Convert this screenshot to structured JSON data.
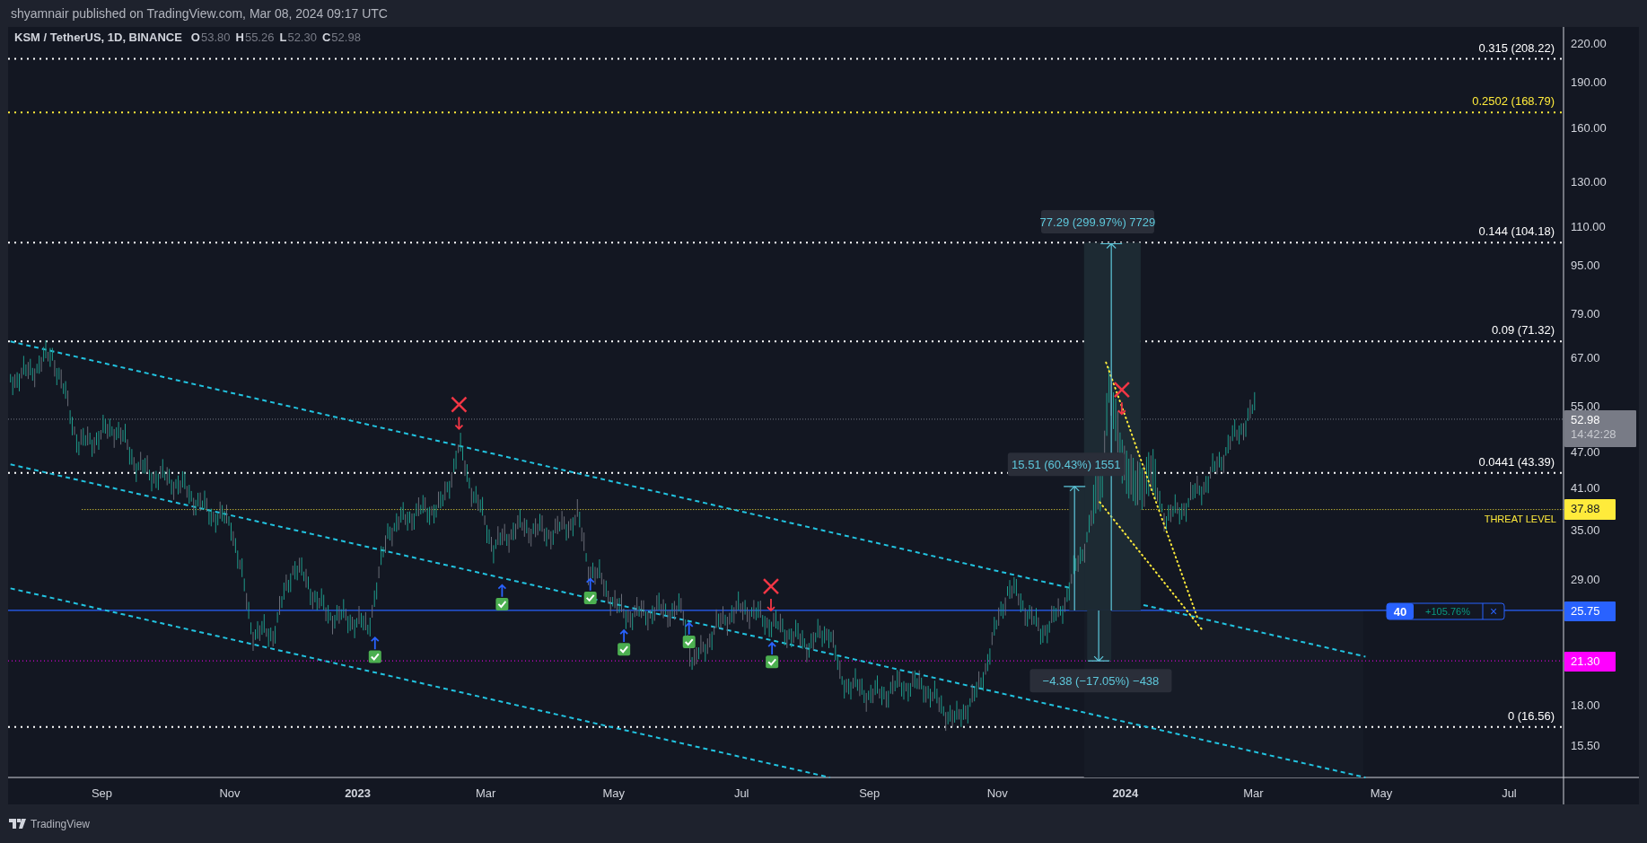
{
  "header": {
    "text": "shyamnair published on TradingView.com, Mar 08, 2024 09:17 UTC"
  },
  "legend": {
    "symbol": "KSM / TetherUS, 1D, BINANCE",
    "ohlc": [
      {
        "label": "O",
        "value": "53.80"
      },
      {
        "label": "H",
        "value": "55.26"
      },
      {
        "label": "L",
        "value": "52.30"
      },
      {
        "label": "C",
        "value": "52.98"
      }
    ]
  },
  "price_axis": [
    "220.00",
    "190.00",
    "160.00",
    "130.00",
    "110.00",
    "95.00",
    "79.00",
    "67.00",
    "55.00",
    "47.00",
    "41.00",
    "35.00",
    "29.00",
    "18.00",
    "15.50"
  ],
  "time_axis": [
    {
      "label": "Sep",
      "kind": "month"
    },
    {
      "label": "Nov",
      "kind": "month"
    },
    {
      "label": "2023",
      "kind": "year"
    },
    {
      "label": "Mar",
      "kind": "month"
    },
    {
      "label": "May",
      "kind": "month"
    },
    {
      "label": "Jul",
      "kind": "month"
    },
    {
      "label": "Sep",
      "kind": "month"
    },
    {
      "label": "Nov",
      "kind": "month"
    },
    {
      "label": "2024",
      "kind": "year"
    },
    {
      "label": "Mar",
      "kind": "month"
    },
    {
      "label": "May",
      "kind": "month"
    },
    {
      "label": "Jul",
      "kind": "month"
    }
  ],
  "fib_levels": [
    {
      "label": "0.315 (208.22)",
      "color": "#ffffff"
    },
    {
      "label": "0.2502 (168.79)",
      "color": "#ffeb3b"
    },
    {
      "label": "0.144 (104.18)",
      "color": "#ffffff"
    },
    {
      "label": "0.09 (71.32)",
      "color": "#ffffff"
    },
    {
      "label": "0.0441 (43.39)",
      "color": "#ffffff"
    },
    {
      "label": "0 (16.56)",
      "color": "#ffffff"
    }
  ],
  "current_price": {
    "price": "52.98",
    "countdown": "14:42:28"
  },
  "threat_level": {
    "label": "THREAT LEVEL",
    "price": "37.88"
  },
  "alert": {
    "count": "40",
    "change": "+105.76%",
    "close": "×",
    "price": "25.75"
  },
  "marked_level": {
    "price": "21.30"
  },
  "measurements": [
    {
      "label": "77.29 (299.97%) 7729"
    },
    {
      "label": "15.51 (60.43%) 1551"
    },
    {
      "label": "−4.38 (−17.05%) −438"
    }
  ],
  "footer": {
    "brand": "TradingView"
  }
}
